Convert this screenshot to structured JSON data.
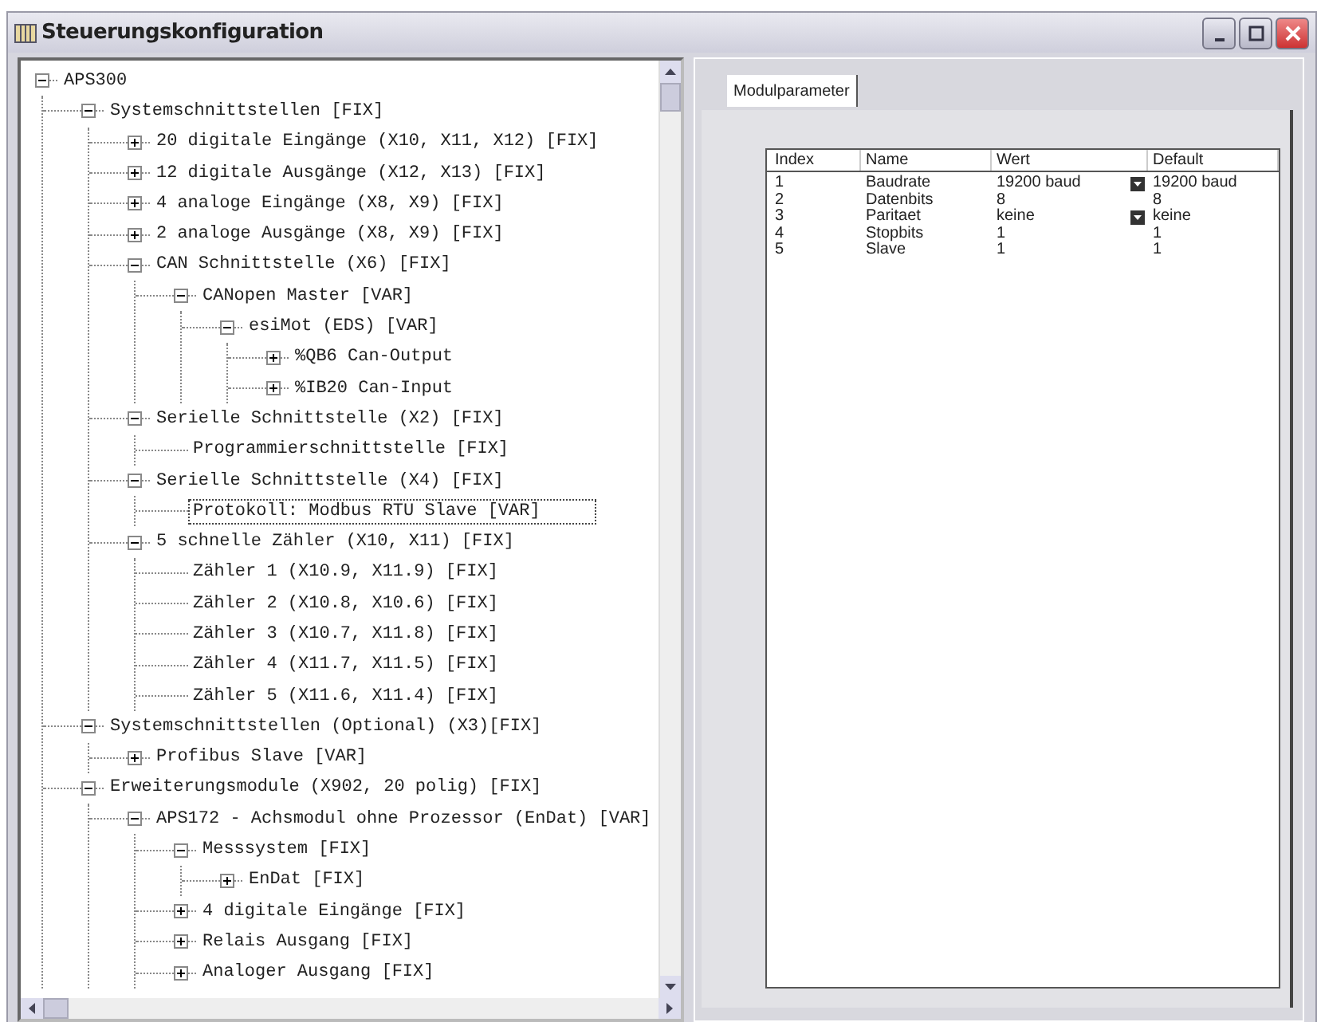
{
  "window": {
    "title": "Steuerungskonfiguration"
  },
  "tree": [
    {
      "label": "APS300",
      "expanded": true,
      "selected": false,
      "children": [
        {
          "label": "Systemschnittstellen [FIX]",
          "expanded": true,
          "selected": false,
          "children": [
            {
              "label": "20 digitale Eingänge (X10, X11, X12) [FIX]",
              "expanded": false,
              "selected": false
            },
            {
              "label": "12 digitale Ausgänge (X12, X13) [FIX]",
              "expanded": false,
              "selected": false
            },
            {
              "label": "4 analoge Eingänge (X8, X9) [FIX]",
              "expanded": false,
              "selected": false
            },
            {
              "label": "2 analoge Ausgänge (X8, X9) [FIX]",
              "expanded": false,
              "selected": false
            },
            {
              "label": "CAN Schnittstelle (X6) [FIX]",
              "expanded": true,
              "selected": false,
              "children": [
                {
                  "label": "CANopen Master [VAR]",
                  "expanded": true,
                  "selected": false,
                  "children": [
                    {
                      "label": "esiMot (EDS)  [VAR]",
                      "expanded": true,
                      "selected": false,
                      "children": [
                        {
                          "label": "%QB6 Can-Output",
                          "expanded": false,
                          "selected": false
                        },
                        {
                          "label": "%IB20 Can-Input",
                          "expanded": false,
                          "selected": false
                        }
                      ]
                    }
                  ]
                }
              ]
            },
            {
              "label": "Serielle Schnittstelle (X2) [FIX]",
              "expanded": true,
              "selected": false,
              "children": [
                {
                  "label": "Programmierschnittstelle [FIX]",
                  "selected": false
                }
              ]
            },
            {
              "label": "Serielle Schnittstelle (X4) [FIX]",
              "expanded": true,
              "selected": false,
              "children": [
                {
                  "label": "Protokoll: Modbus RTU Slave [VAR]",
                  "selected": true
                }
              ]
            },
            {
              "label": "5 schnelle Zähler (X10, X11) [FIX]",
              "expanded": true,
              "selected": false,
              "children": [
                {
                  "label": "Zähler 1 (X10.9, X11.9) [FIX]",
                  "selected": false
                },
                {
                  "label": "Zähler 2 (X10.8, X10.6) [FIX]",
                  "selected": false
                },
                {
                  "label": "Zähler 3 (X10.7, X11.8) [FIX]",
                  "selected": false
                },
                {
                  "label": "Zähler 4 (X11.7, X11.5) [FIX]",
                  "selected": false
                },
                {
                  "label": "Zähler 5 (X11.6, X11.4) [FIX]",
                  "selected": false
                }
              ]
            }
          ]
        },
        {
          "label": "Systemschnittstellen (Optional) (X3)[FIX]",
          "expanded": true,
          "selected": false,
          "children": [
            {
              "label": "Profibus Slave [VAR]",
              "expanded": false,
              "selected": false
            }
          ]
        },
        {
          "label": "Erweiterungsmodule (X902, 20 polig) [FIX]",
          "expanded": true,
          "selected": false,
          "children": [
            {
              "label": "APS172 - Achsmodul ohne Prozessor (EnDat) [VAR]",
              "expanded": true,
              "selected": false,
              "children": [
                {
                  "label": "Messsystem [FIX]",
                  "expanded": true,
                  "selected": false,
                  "children": [
                    {
                      "label": "EnDat [FIX]",
                      "expanded": false,
                      "selected": false
                    }
                  ]
                },
                {
                  "label": "4 digitale Eingänge [FIX]",
                  "expanded": false,
                  "selected": false
                },
                {
                  "label": "Relais Ausgang [FIX]",
                  "expanded": false,
                  "selected": false
                },
                {
                  "label": "Analoger Ausgang [FIX]",
                  "expanded": false,
                  "selected": false
                }
              ]
            }
          ]
        }
      ]
    }
  ],
  "tabs": [
    {
      "label": "Modulparameter",
      "selected": true
    }
  ],
  "table": {
    "columns": [
      "Index",
      "Name",
      "Wert",
      "Default"
    ],
    "rows": [
      {
        "index": "1",
        "name": "Baudrate",
        "value": "19200 baud",
        "kind": "dropdown",
        "default": "19200 baud"
      },
      {
        "index": "2",
        "name": "Datenbits",
        "value": "8",
        "kind": "text",
        "default": "8"
      },
      {
        "index": "3",
        "name": "Paritaet",
        "value": "keine",
        "kind": "dropdown",
        "default": "keine"
      },
      {
        "index": "4",
        "name": "Stopbits",
        "value": "1",
        "kind": "text",
        "default": "1"
      },
      {
        "index": "5",
        "name": "Slave",
        "value": "1",
        "kind": "text",
        "default": "1"
      }
    ]
  }
}
